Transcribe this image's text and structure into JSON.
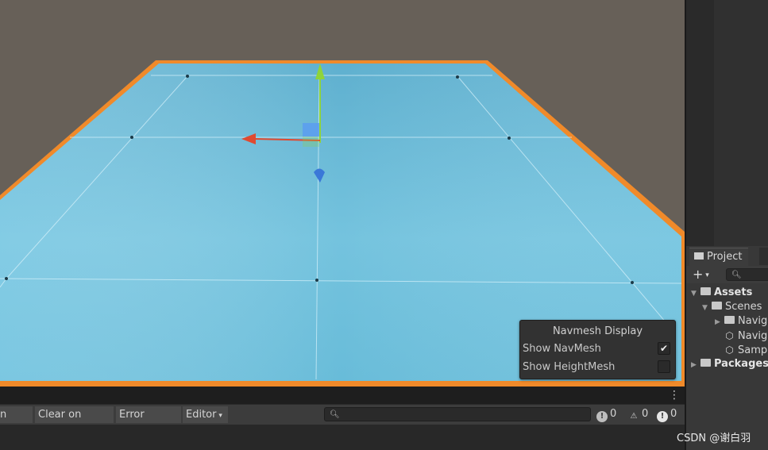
{
  "scene": {
    "colors": {
      "background": "#676058",
      "plane": "#6ab9d4",
      "edge": "#f08020"
    },
    "gizmo": {
      "x_axis_color": "#e04a30",
      "y_axis_color": "#8fd43a",
      "z_axis_color": "#3a78d8"
    }
  },
  "navmesh_display": {
    "title": "Navmesh Display",
    "show_navmesh_label": "Show NavMesh",
    "show_navmesh_checked": true,
    "show_heightmesh_label": "Show HeightMesh",
    "show_heightmesh_checked": false
  },
  "project": {
    "tab_label": "Project",
    "add_icon": "plus-icon",
    "tree": [
      {
        "label": "Assets",
        "indent": 0,
        "icon": "folder-open-icon",
        "expanded": true,
        "bold": true
      },
      {
        "label": "Scenes",
        "indent": 1,
        "icon": "folder-open-icon",
        "expanded": true,
        "bold": false
      },
      {
        "label": "Navig",
        "indent": 2,
        "icon": "folder-icon",
        "expanded": false,
        "bold": false
      },
      {
        "label": "Navig",
        "indent": 2,
        "icon": "unity-scene-icon",
        "expanded": null,
        "bold": false
      },
      {
        "label": "Samp",
        "indent": 2,
        "icon": "unity-scene-icon",
        "expanded": null,
        "bold": false
      },
      {
        "label": "Packages",
        "indent": 0,
        "icon": "folder-icon",
        "expanded": false,
        "bold": true
      }
    ]
  },
  "console": {
    "buttons": {
      "play": "n Play",
      "clear_on_build": "Clear on Build",
      "error_pause": "Error Pause",
      "editor": "Editor"
    },
    "counts": {
      "log": "0",
      "warning": "0",
      "error": "0"
    }
  },
  "watermark": "CSDN @谢白羽"
}
